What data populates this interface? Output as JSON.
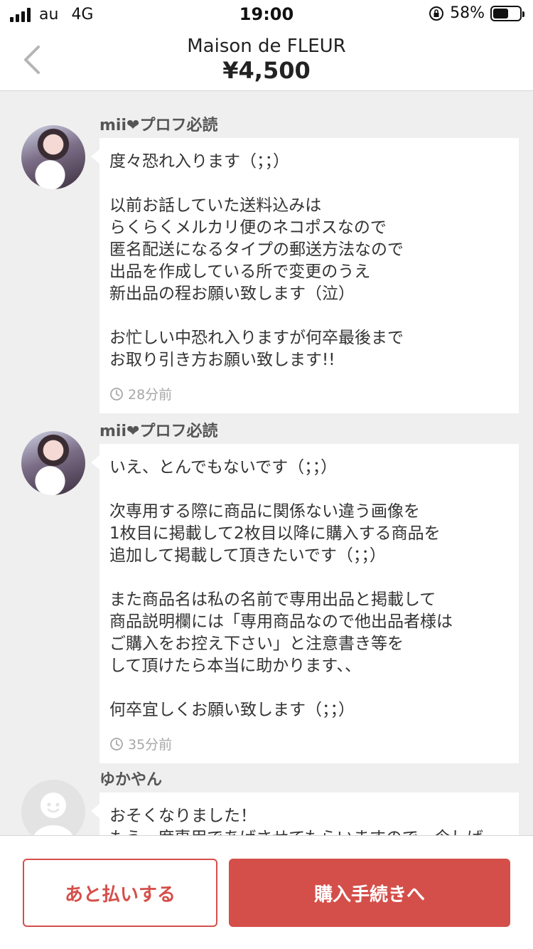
{
  "status_bar": {
    "carrier": "au",
    "network": "4G",
    "time": "19:00",
    "battery": "58%",
    "battery_level": 0.58
  },
  "header": {
    "title": "Maison de FLEUR",
    "price": "¥4,500"
  },
  "messages": [
    {
      "sender": "mii❤プロフ必読",
      "avatar": "photo",
      "text": "度々恐れ入ります（；；）\n\n以前お話していた送料込みは\nらくらくメルカリ便のネコポスなので\n匿名配送になるタイプの郵送方法なので\n出品を作成している所で変更のうえ\n新出品の程お願い致します（泣）\n\nお忙しい中恐れ入りますが何卒最後まで\nお取り引き方お願い致します!!",
      "time": "28分前"
    },
    {
      "sender": "mii❤プロフ必読",
      "avatar": "photo",
      "text": "いえ、とんでもないです（；；）\n\n次専用する際に商品に関係ない違う画像を\n1枚目に掲載して2枚目以降に購入する商品を\n追加して掲載して頂きたいです（；；）\n\nまた商品名は私の名前で専用出品と掲載して\n商品説明欄には「専用商品なので他出品者様は\nご購入をお控え下さい」と注意書き等を\nして頂けたら本当に助かります、、\n\n何卒宜しくお願い致します（；；）",
      "time": "35分前"
    },
    {
      "sender": "ゆかやん",
      "avatar": "default",
      "text": "おそくなりました！\nもう一度専用であげさせてもらいますので、今しば",
      "time": ""
    }
  ],
  "actions": {
    "pay_later": "あと払いする",
    "purchase": "購入手続きへ"
  },
  "colors": {
    "accent": "#d44f4a",
    "background": "#efefef"
  }
}
